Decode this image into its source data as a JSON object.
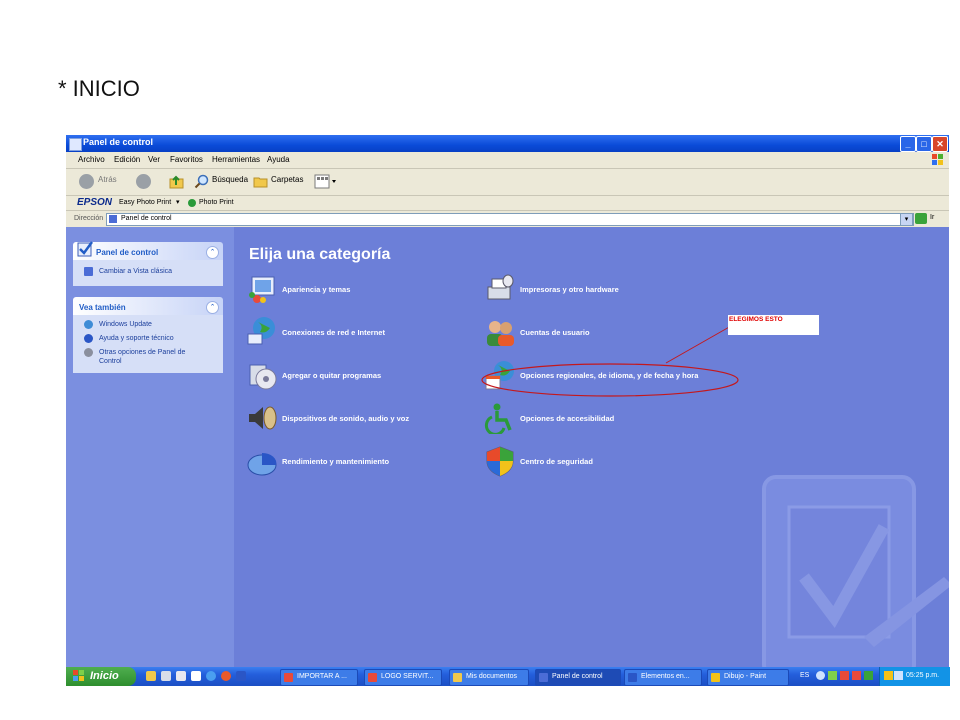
{
  "slide": {
    "title": "* INICIO"
  },
  "window": {
    "title": "Panel de control",
    "menu": [
      "Archivo",
      "Edición",
      "Ver",
      "Favoritos",
      "Herramientas",
      "Ayuda"
    ],
    "toolbar": {
      "back": "Atrás",
      "search": "Búsqueda",
      "folders": "Carpetas"
    },
    "epson_bar": {
      "logo": "EPSON",
      "easy": "Easy Photo Print",
      "photo": "Photo Print"
    },
    "address": {
      "label": "Dirección",
      "value": "Panel de control",
      "go": "Ir"
    }
  },
  "sidebar": {
    "panel1": {
      "title": "Panel de control",
      "link": "Cambiar a Vista clásica"
    },
    "panel2": {
      "title": "Vea también",
      "links": [
        "Windows Update",
        "Ayuda y soporte técnico",
        "Otras opciones de Panel de",
        "Control"
      ]
    }
  },
  "content": {
    "heading": "Elija una categoría",
    "left": [
      "Apariencia y temas",
      "Conexiones de red e Internet",
      "Agregar o quitar programas",
      "Dispositivos de sonido, audio y voz",
      "Rendimiento y mantenimiento"
    ],
    "right": [
      "Impresoras y otro hardware",
      "Cuentas de usuario",
      "Opciones regionales, de idioma, y de fecha y hora",
      "Opciones de accesibilidad",
      "Centro de seguridad"
    ]
  },
  "annotation": {
    "text": "ELEGIMOS ESTO",
    "color": "#e00000"
  },
  "taskbar": {
    "start": "Inicio",
    "tasks": [
      "IMPORTAR A ...",
      "LOGO SERVIT...",
      "Mis documentos",
      "Panel de control",
      "Elementos en...",
      "Dibujo - Paint"
    ],
    "lang": "ES",
    "clock": "05:25 p.m."
  }
}
